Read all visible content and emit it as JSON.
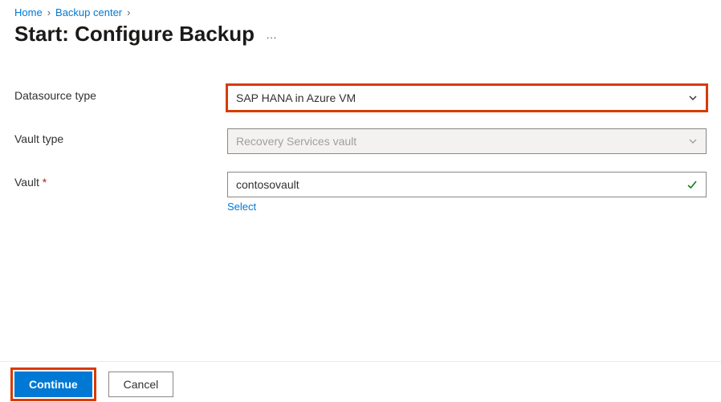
{
  "breadcrumb": {
    "home": "Home",
    "backup_center": "Backup center"
  },
  "page_title": "Start: Configure Backup",
  "form": {
    "datasource_type": {
      "label": "Datasource type",
      "value": "SAP HANA in Azure VM"
    },
    "vault_type": {
      "label": "Vault type",
      "value": "Recovery Services vault"
    },
    "vault": {
      "label": "Vault",
      "value": "contosovault",
      "select_link": "Select"
    }
  },
  "footer": {
    "continue": "Continue",
    "cancel": "Cancel"
  }
}
